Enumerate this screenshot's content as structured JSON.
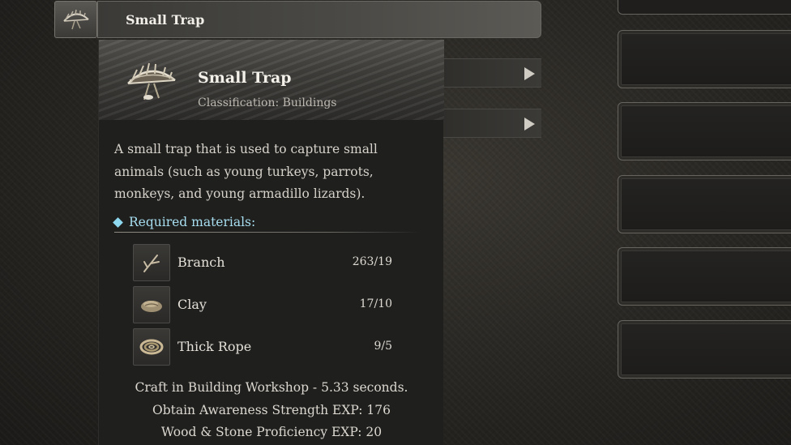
{
  "header": {
    "title": "Small Trap",
    "icon": "small-trap-icon"
  },
  "tooltip": {
    "title": "Small Trap",
    "classification": "Classification: Buildings",
    "description": "A small trap that is used to capture small animals (such as young turkeys, parrots, monkeys, and young armadillo lizards).",
    "required_label": "Required materials:",
    "materials": [
      {
        "name": "Branch",
        "count": "263/19",
        "icon": "branch-icon"
      },
      {
        "name": "Clay",
        "count": "17/10",
        "icon": "clay-icon"
      },
      {
        "name": "Thick Rope",
        "count": "9/5",
        "icon": "rope-icon"
      }
    ],
    "craft_info": "Craft in Building Workshop - 5.33 seconds.",
    "exp_awareness": "Obtain Awareness Strength EXP: 176",
    "exp_proficiency": "Wood & Stone Proficiency EXP: 20"
  },
  "colors": {
    "accent": "#a8dff0",
    "panel": "#1f1f1e"
  }
}
